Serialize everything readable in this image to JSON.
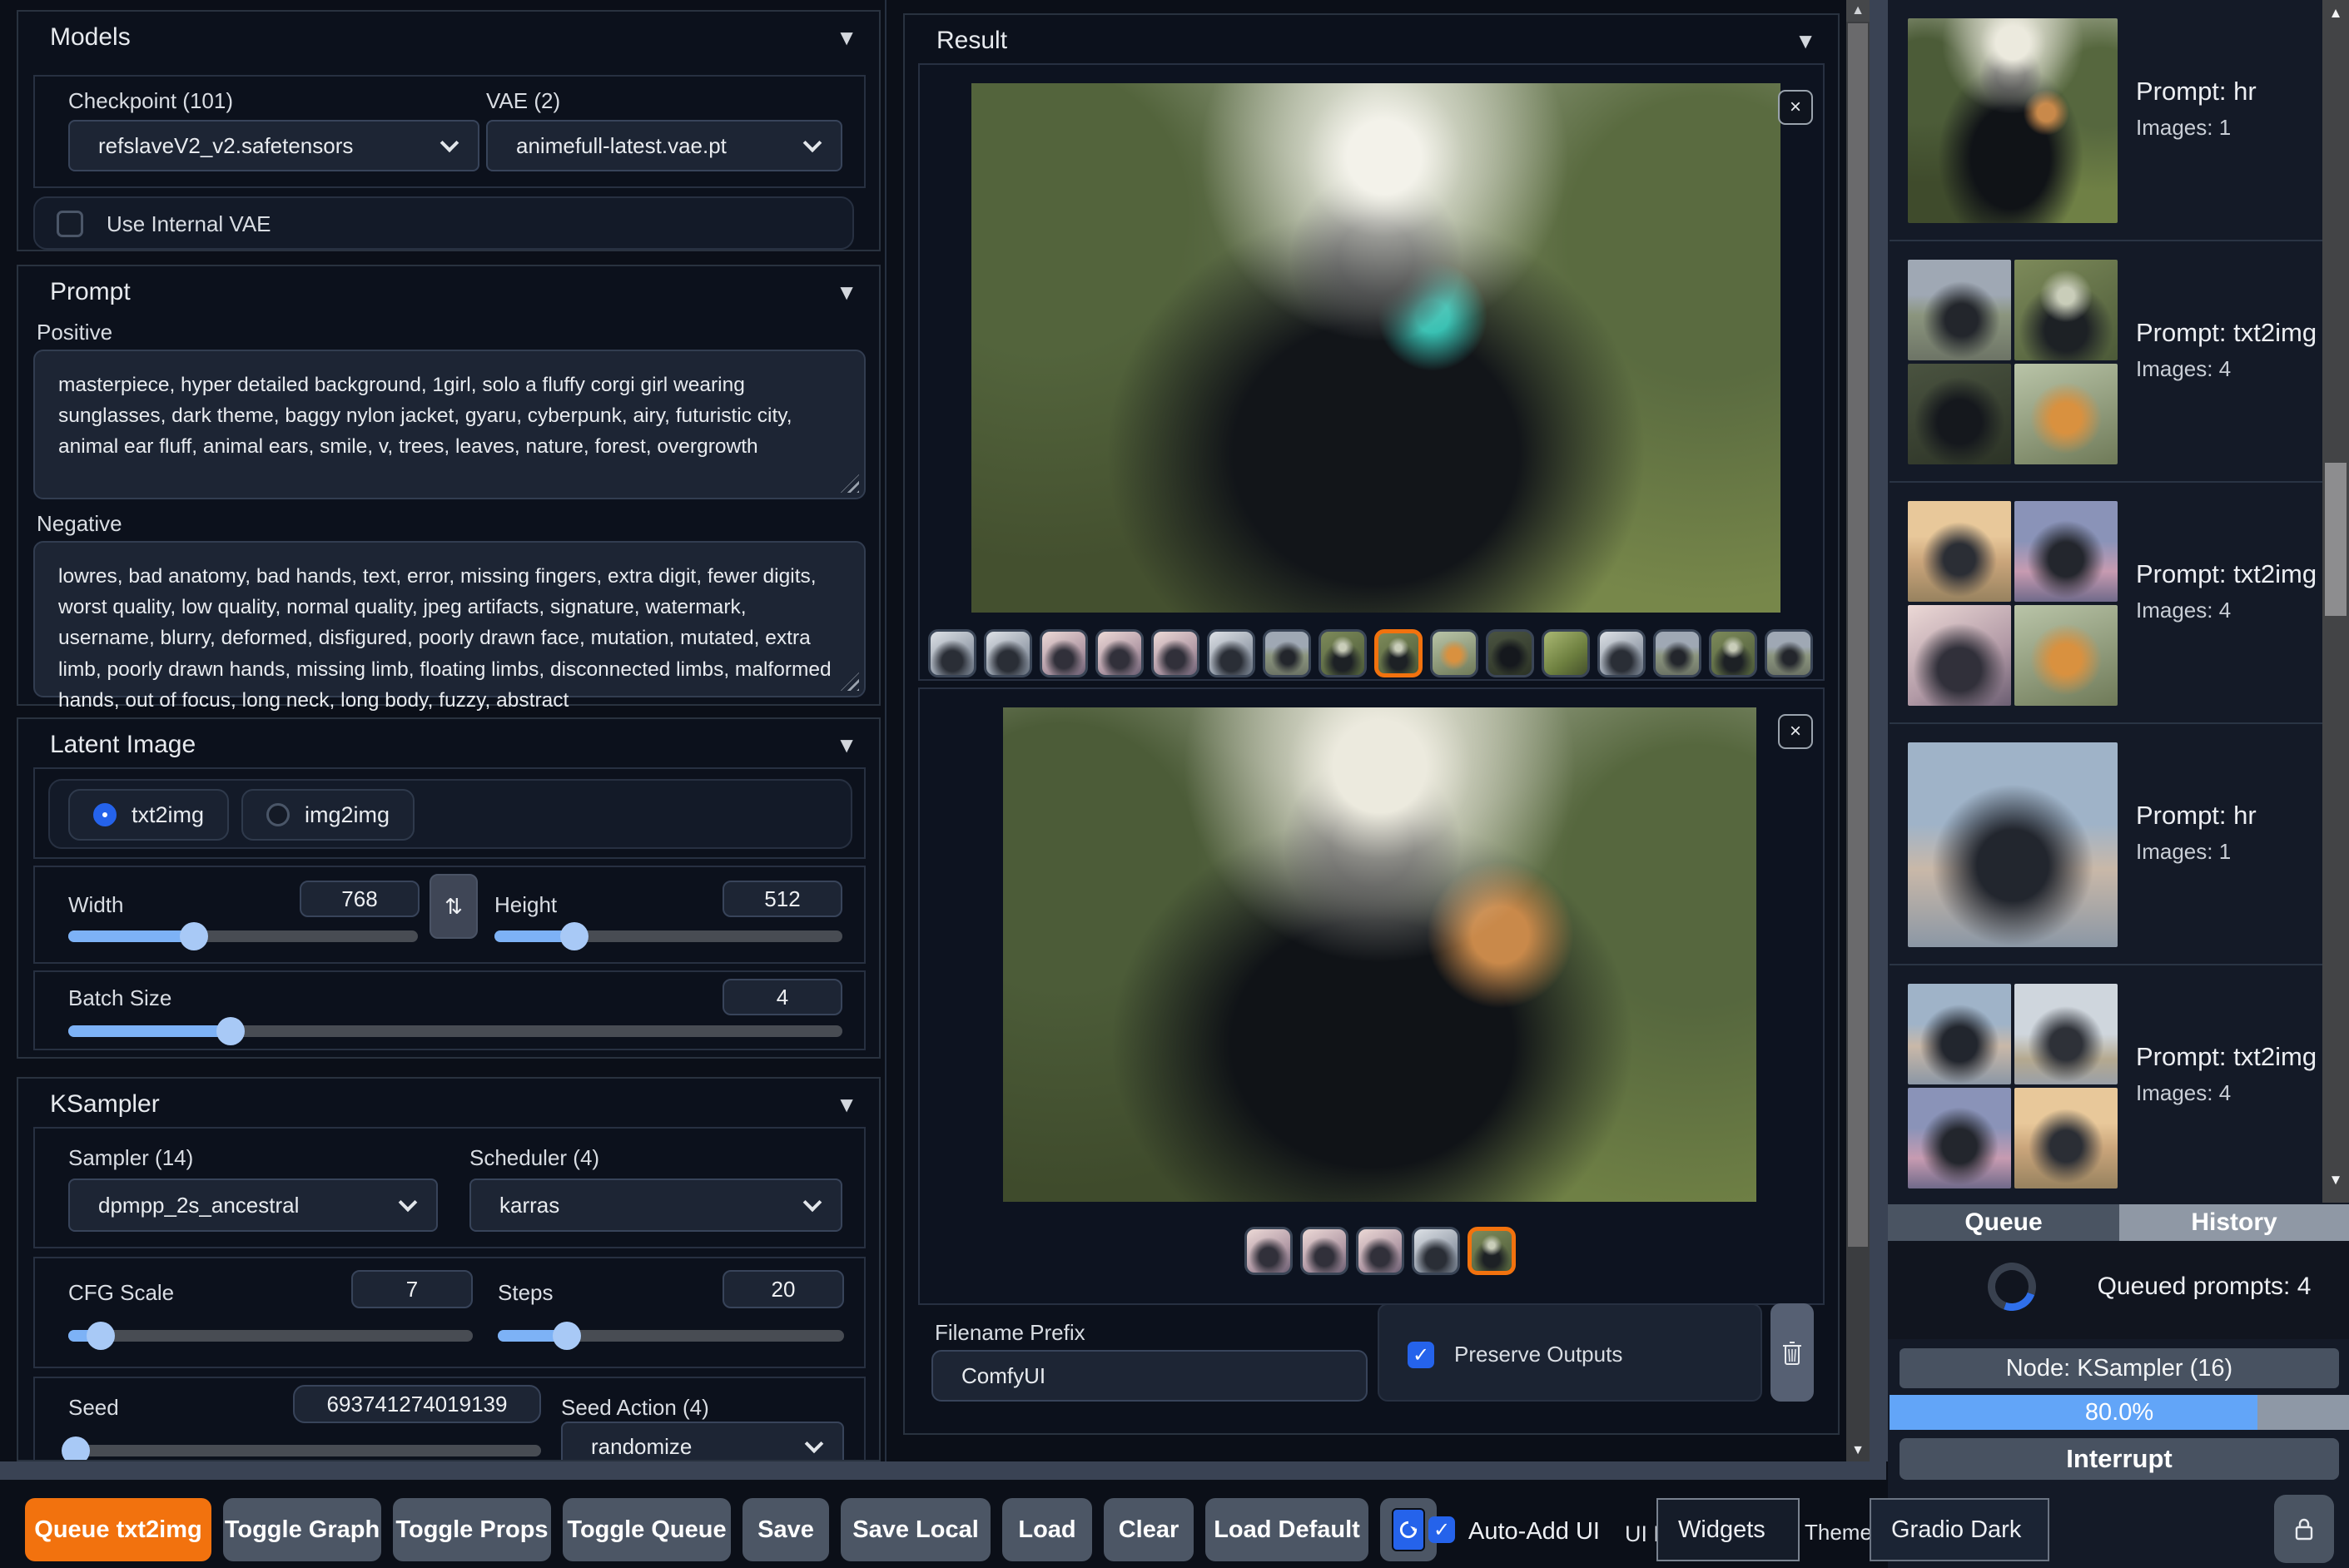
{
  "accent": {
    "orange": "#f2720e",
    "blue": "#2563eb",
    "slider_fill": "#7db2f6",
    "progress_fill": "#62a5f8"
  },
  "left": {
    "models": {
      "title": "Models",
      "checkpoint_label": "Checkpoint (101)",
      "checkpoint_value": "refslaveV2_v2.safetensors",
      "vae_label": "VAE (2)",
      "vae_value": "animefull-latest.vae.pt",
      "use_internal_vae_label": "Use Internal VAE",
      "use_internal_vae_checked": false
    },
    "prompt": {
      "title": "Prompt",
      "positive_label": "Positive",
      "positive_value": "masterpiece, hyper detailed background, 1girl, solo a fluffy corgi girl wearing sunglasses, dark theme, baggy nylon jacket, gyaru, cyberpunk, airy, futuristic city, animal ear fluff, animal ears, smile, v, trees, leaves, nature, forest, overgrowth",
      "negative_label": "Negative",
      "negative_value": "lowres, bad anatomy, bad hands, text, error, missing fingers, extra digit, fewer digits, worst quality, low quality, normal quality, jpeg artifacts, signature, watermark, username, blurry, deformed, disfigured, poorly drawn face, mutation, mutated, extra limb, poorly drawn hands, missing limb, floating limbs, disconnected limbs, malformed hands, out of focus, long neck, long body, fuzzy, abstract"
    },
    "latent": {
      "title": "Latent Image",
      "mode_txt2img": "txt2img",
      "mode_img2img": "img2img",
      "selected_mode": "txt2img",
      "width_label": "Width",
      "width_value": "768",
      "height_label": "Height",
      "height_value": "512",
      "batch_label": "Batch Size",
      "batch_value": "4"
    },
    "ksampler": {
      "title": "KSampler",
      "sampler_label": "Sampler (14)",
      "sampler_value": "dpmpp_2s_ancestral",
      "scheduler_label": "Scheduler (4)",
      "scheduler_value": "karras",
      "cfg_label": "CFG Scale",
      "cfg_value": "7",
      "steps_label": "Steps",
      "steps_value": "20",
      "seed_label": "Seed",
      "seed_value": "693741274019139",
      "seed_action_label": "Seed Action (4)",
      "seed_action_value": "randomize"
    }
  },
  "result": {
    "title": "Result",
    "close_label": "×",
    "gallery1": {
      "count": 17,
      "selected": 9
    },
    "gallery2": {
      "count": 5,
      "selected": 5
    },
    "filename_prefix_label": "Filename Prefix",
    "filename_prefix_value": "ComfyUI",
    "preserve_outputs_label": "Preserve Outputs",
    "preserve_outputs_checked": true
  },
  "history": {
    "items": [
      {
        "prompt": "Prompt: hr",
        "images": "Images: 1"
      },
      {
        "prompt": "Prompt: txt2img",
        "images": "Images: 4"
      },
      {
        "prompt": "Prompt: txt2img",
        "images": "Images: 4"
      },
      {
        "prompt": "Prompt: hr",
        "images": "Images: 1"
      },
      {
        "prompt": "Prompt: txt2img",
        "images": "Images: 4"
      }
    ],
    "tab_queue": "Queue",
    "tab_history": "History",
    "active_tab": "History",
    "queued_text": "Queued prompts: 4",
    "node_text": "Node: KSampler (16)",
    "progress_text": "80.0%",
    "progress_value": 80,
    "interrupt_label": "Interrupt"
  },
  "toolbar": {
    "buttons": [
      "Queue txt2img",
      "Toggle Graph",
      "Toggle Props",
      "Toggle Queue",
      "Save",
      "Save Local",
      "Load",
      "Clear",
      "Load Default"
    ],
    "auto_add_label": "Auto-Add UI",
    "auto_add_checked": true,
    "ui_edit_label": "UI Edit mode",
    "widgets_value": "Widgets",
    "theme_label": "Theme",
    "theme_value": "Gradio Dark"
  }
}
